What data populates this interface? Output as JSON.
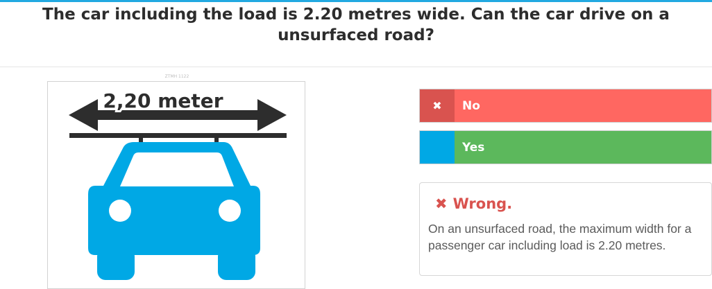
{
  "question": "The car including the load is 2.20 metres wide. Can the car drive on a unsurfaced road?",
  "image": {
    "id_label": "ZTMH 1122",
    "width_label": "2,20 meter"
  },
  "answers": [
    {
      "mark_icon": "cross-icon",
      "mark": "✖",
      "label": "No",
      "mark_color": "#d9534f",
      "label_color": "#ff6761"
    },
    {
      "mark_icon": "",
      "mark": "",
      "label": "Yes",
      "mark_color": "#00a8e5",
      "label_color": "#5cb85c"
    }
  ],
  "feedback": {
    "icon": "cross-icon",
    "title": "Wrong.",
    "text": "On an unsurfaced road, the maximum width for a passenger car including load is 2.20 metres."
  },
  "colors": {
    "accent": "#22a9e1",
    "car": "#00a8e5",
    "wrong": "#d9534f",
    "correct": "#5cb85c"
  }
}
